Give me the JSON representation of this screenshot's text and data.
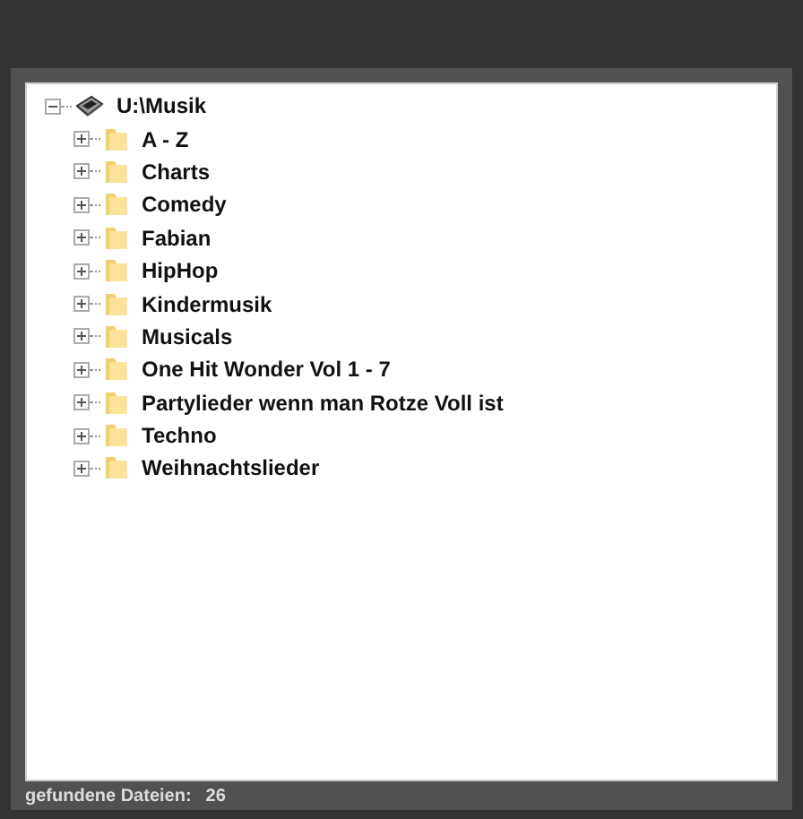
{
  "tree": [
    {
      "label": "U:\\Musik",
      "kind": "drive",
      "expanded": true,
      "children": [
        {
          "label": "A - Z",
          "kind": "folder",
          "expanded": false
        },
        {
          "label": "Charts",
          "kind": "folder",
          "expanded": false
        },
        {
          "label": "Comedy",
          "kind": "folder",
          "expanded": false
        },
        {
          "label": "Fabian",
          "kind": "folder",
          "expanded": false
        },
        {
          "label": "HipHop",
          "kind": "folder",
          "expanded": false
        },
        {
          "label": "Kindermusik",
          "kind": "folder",
          "expanded": false
        },
        {
          "label": "Musicals",
          "kind": "folder",
          "expanded": false
        },
        {
          "label": "One Hit Wonder Vol 1 - 7",
          "kind": "folder",
          "expanded": false
        },
        {
          "label": "Partylieder wenn man Rotze Voll ist",
          "kind": "folder",
          "expanded": false
        },
        {
          "label": "Techno",
          "kind": "folder",
          "expanded": false
        },
        {
          "label": "Weihnachtslieder",
          "kind": "folder",
          "expanded": false
        }
      ]
    }
  ],
  "status_bar": {
    "label": "gefundene Dateien:",
    "count": "26"
  }
}
